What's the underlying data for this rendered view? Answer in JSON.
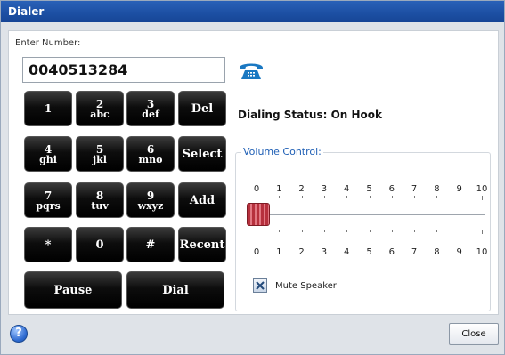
{
  "window": {
    "title": "Dialer"
  },
  "dialer": {
    "enter_label": "Enter Number:",
    "number_value": "0040513284"
  },
  "keypad": {
    "k1": {
      "digit": "1",
      "letters": ""
    },
    "k2": {
      "digit": "2",
      "letters": "abc"
    },
    "k3": {
      "digit": "3",
      "letters": "def"
    },
    "del": "Del",
    "k4": {
      "digit": "4",
      "letters": "ghi"
    },
    "k5": {
      "digit": "5",
      "letters": "jkl"
    },
    "k6": {
      "digit": "6",
      "letters": "mno"
    },
    "select": "Select",
    "k7": {
      "digit": "7",
      "letters": "pqrs"
    },
    "k8": {
      "digit": "8",
      "letters": "tuv"
    },
    "k9": {
      "digit": "9",
      "letters": "wxyz"
    },
    "add": "Add",
    "star": "*",
    "k0": "0",
    "hash": "#",
    "recent": "Recent",
    "pause": "Pause",
    "dial": "Dial"
  },
  "status": {
    "text": "Dialing Status: On Hook"
  },
  "volume": {
    "legend": "Volume Control:",
    "ticks": [
      "0",
      "1",
      "2",
      "3",
      "4",
      "5",
      "6",
      "7",
      "8",
      "9",
      "10"
    ],
    "value": 0,
    "min": 0,
    "max": 10
  },
  "mute": {
    "label": "Mute Speaker",
    "checked": true
  },
  "footer": {
    "help_icon": "?",
    "close_label": "Close"
  },
  "icons": {
    "phone": "phone-icon",
    "help": "help-icon",
    "mute": "checkbox-x-icon"
  },
  "colors": {
    "titlebar": "#1c4fa3",
    "accent": "#1f5fb5",
    "slider_thumb": "#b6303d",
    "phone_icon": "#1a78c2"
  }
}
